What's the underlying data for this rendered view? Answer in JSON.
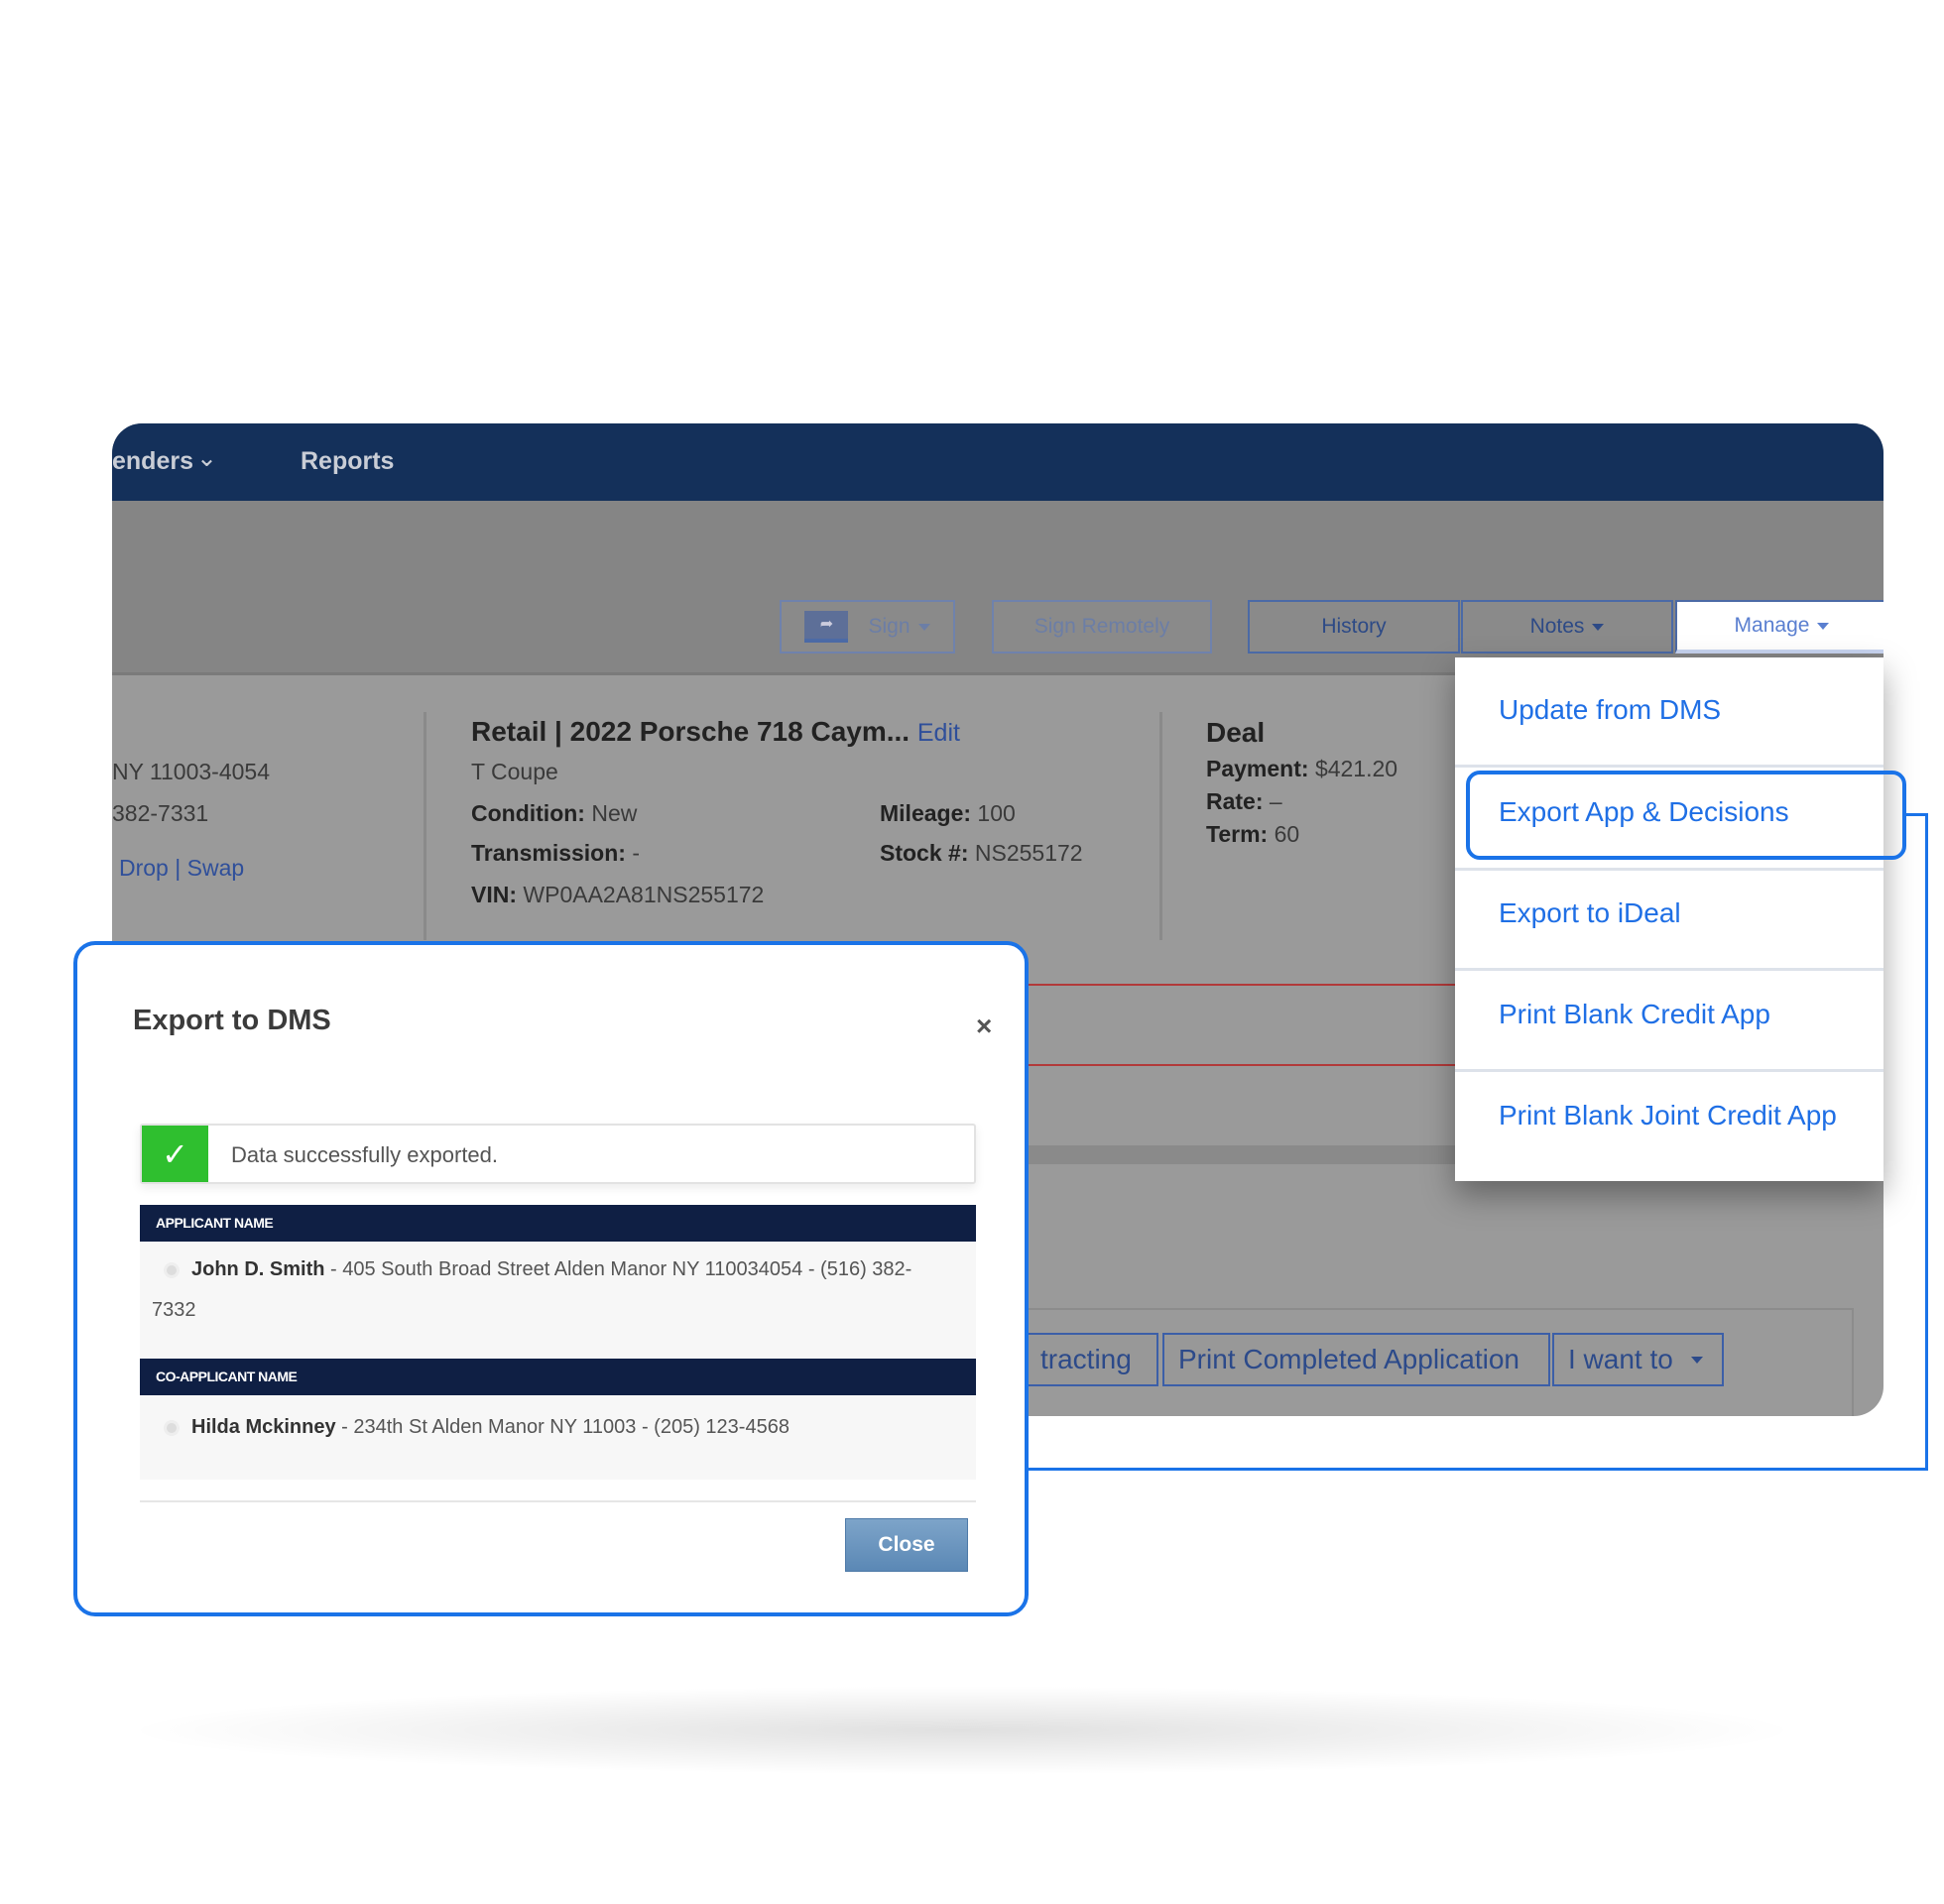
{
  "nav": {
    "lenders": "enders",
    "reports": "Reports"
  },
  "toolbar": {
    "sign": "Sign",
    "sign_remotely": "Sign Remotely",
    "history": "History",
    "notes": "Notes",
    "manage": "Manage"
  },
  "customer": {
    "address_tail": "NY 11003-4054",
    "phone_tail": "382-7331",
    "drop": "Drop",
    "sep": "|",
    "swap": "Swap"
  },
  "vehicle": {
    "title": "Retail | 2022 Porsche 718 Caym...",
    "edit": "Edit",
    "trim": "T Coupe",
    "condition_label": "Condition:",
    "condition": "New",
    "transmission_label": "Transmission:",
    "transmission": "-",
    "vin_label": "VIN:",
    "vin": "WP0AA2A81NS255172",
    "mileage_label": "Mileage:",
    "mileage": "100",
    "stock_label": "Stock #:",
    "stock": "NS255172"
  },
  "deal": {
    "title": "Deal",
    "payment_label": "Payment:",
    "payment": "$421.20",
    "rate_label": "Rate:",
    "rate": "–",
    "term_label": "Term:",
    "term": "60"
  },
  "bottom_buttons": {
    "contracting": "tracting",
    "print_completed": "Print Completed Application",
    "i_want_to": "I want to"
  },
  "manage_menu": {
    "items": [
      "Update from DMS",
      "Export App & Decisions",
      "Export to iDeal",
      "Print Blank Credit App",
      "Print Blank Joint Credit App"
    ],
    "highlighted": "Export App & Decisions"
  },
  "modal": {
    "title": "Export to DMS",
    "close_x": "×",
    "success": "Data successfully exported.",
    "applicant_header": "APPLICANT NAME",
    "applicant_name": "John D. Smith",
    "applicant_details": " - 405 South Broad Street Alden Manor NY 110034054 - (516) 382-",
    "applicant_details_wrap": "7332",
    "coapplicant_header": "CO-APPLICANT NAME",
    "coapplicant_name": "Hilda Mckinney",
    "coapplicant_details": " - 234th St Alden Manor NY 11003 - (205) 123-4568",
    "close_button": "Close"
  },
  "colors": {
    "navbar": "#14305a",
    "accent": "#1a73e8",
    "success": "#2fbf2f",
    "table_header": "#0f1f44"
  }
}
